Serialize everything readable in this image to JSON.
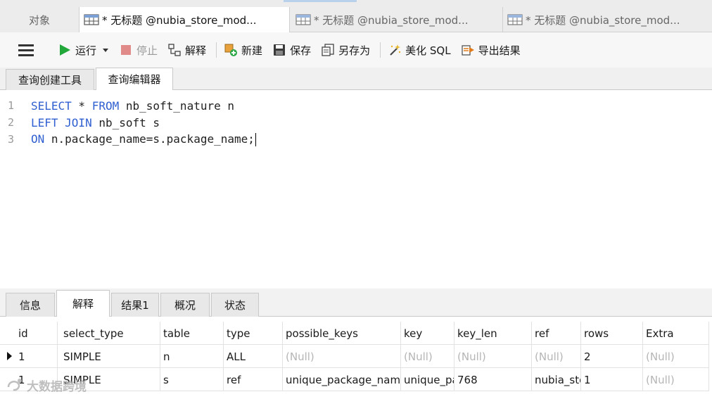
{
  "tabs": {
    "objects_label": "对象",
    "query_tabs": [
      "* 无标题 @nubia_store_mod...",
      "* 无标题 @nubia_store_mod...",
      "* 无标题 @nubia_store_mod..."
    ]
  },
  "toolbar": {
    "run": "运行",
    "stop": "停止",
    "explain": "解释",
    "new": "新建",
    "save": "保存",
    "save_as": "另存为",
    "beautify": "美化 SQL",
    "export": "导出结果"
  },
  "subtabs": {
    "builder": "查询创建工具",
    "editor": "查询编辑器"
  },
  "editor": {
    "lines": [
      {
        "n": "1",
        "kw1": "SELECT",
        "t1": " * ",
        "kw2": "FROM",
        "t2": " nb_soft_nature n"
      },
      {
        "n": "2",
        "kw1": "LEFT JOIN",
        "t1": " nb_soft s",
        "kw2": "",
        "t2": ""
      },
      {
        "n": "3",
        "kw1": "ON",
        "t1": " n.package_name=s.package_name;",
        "kw2": "",
        "t2": ""
      }
    ]
  },
  "result_tabs": [
    "信息",
    "解释",
    "结果1",
    "概况",
    "状态"
  ],
  "explain_table": {
    "columns": [
      "id",
      "select_type",
      "table",
      "type",
      "possible_keys",
      "key",
      "key_len",
      "ref",
      "rows",
      "Extra"
    ],
    "rows": [
      [
        "1",
        "SIMPLE",
        "n",
        "ALL",
        "(Null)",
        "(Null)",
        "(Null)",
        "(Null)",
        "2",
        "(Null)"
      ],
      [
        "1",
        "SIMPLE",
        "s",
        "ref",
        "unique_package_name",
        "unique_package_name",
        "768",
        "nubia_store_model.n.package_name",
        "1",
        "(Null)"
      ]
    ]
  },
  "watermark": "大数据跨境",
  "colors": {
    "keyword": "#2f5fd0",
    "null_text": "#b5b5b5",
    "run_icon": "#22a83a",
    "stop_icon": "#e08a8a"
  }
}
